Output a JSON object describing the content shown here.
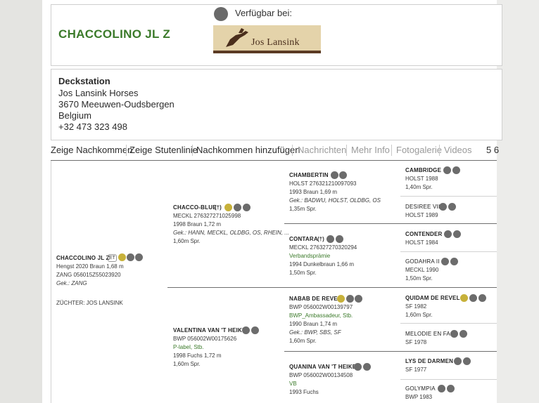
{
  "horse": {
    "name": "CHACCOLINO JL Z",
    "available_label": "Verfügbar bei:",
    "available_logo_text": "Jos Lansink"
  },
  "station": {
    "heading": "Deckstation",
    "lines": [
      "Jos Lansink Horses",
      "3670 Meeuwen-Oudsbergen",
      "Belgium",
      "+32 473 323 498"
    ]
  },
  "nav": {
    "items": [
      "Zeige Nachkommen",
      "Zeige Stutenlinie",
      "Nachkommen hinzufügen",
      "Nachrichten",
      "Mehr Info",
      "Fotogalerie",
      "Videos"
    ],
    "overflow": "5 6"
  },
  "pedigree": {
    "root": {
      "name": "CHACCOLINO JL Z",
      "badge": "ET",
      "lines": [
        "Hengst 2020 Braun 1,68 m",
        "ZANG 056015Z55023920",
        "Gek.: ZANG"
      ],
      "breeder": "ZÜCHTER: JOS LANSINK"
    },
    "sire": {
      "name": "CHACCO-BLUE",
      "cross": "(†)",
      "lines": [
        "MECKL 276327271025998",
        "1998 Braun 1,72 m",
        "Gek.: HANN, MECKL, OLDBG, OS, RHEIN, ...",
        "1,60m Spr."
      ]
    },
    "dam": {
      "name": "VALENTINA VAN 'T HEIKE",
      "lines": [
        "BWP 056002W00175626",
        "P-label, Stb.",
        "1998 Fuchs 1,72 m",
        "1,60m Spr."
      ]
    },
    "ss": {
      "name": "CHAMBERTIN",
      "lines": [
        "HOLST 276321210097093",
        "1993 Braun 1,69 m",
        "Gek.: BADWU, HOLST, OLDBG, OS",
        "1,35m Spr."
      ]
    },
    "sd": {
      "name": "CONTARA",
      "cross": "(†)",
      "lines": [
        "MECKL 276327270320294",
        "Verbandsprämie",
        "1994 Dunkelbraun 1,66 m",
        "1,50m Spr."
      ]
    },
    "ds": {
      "name": "NABAB DE REVE",
      "lines": [
        "BWP 056002W00139797",
        "BWP_Ambassadeur, Stb.",
        "1990 Braun 1,74 m",
        "Gek.: BWP, SBS, SF",
        "1,60m Spr."
      ]
    },
    "dd": {
      "name": "QUANINA VAN 'T HEIKE",
      "lines": [
        "BWP 056002W00134508",
        "VB",
        "1993 Fuchs"
      ]
    },
    "sss": {
      "name": "CAMBRIDGE",
      "lines": [
        "HOLST 1988",
        "1,40m Spr."
      ]
    },
    "ssd": {
      "name": "DESIREE VII",
      "lines": [
        "HOLST 1989"
      ]
    },
    "sds": {
      "name": "CONTENDER",
      "lines": [
        "HOLST 1984"
      ]
    },
    "sdd": {
      "name": "GODAHRA II",
      "lines": [
        "MECKL 1990",
        "1,50m Spr."
      ]
    },
    "dss": {
      "name": "QUIDAM DE REVEL",
      "lines": [
        "SF 1982",
        "1,60m Spr."
      ]
    },
    "dsd": {
      "name": "MELODIE EN FA",
      "lines": [
        "SF 1978"
      ]
    },
    "dds": {
      "name": "LYS DE DARMEN",
      "lines": [
        "SF 1977"
      ]
    },
    "ddd": {
      "name": "GOLYMPIA",
      "lines": [
        "BWP 1983"
      ]
    }
  }
}
